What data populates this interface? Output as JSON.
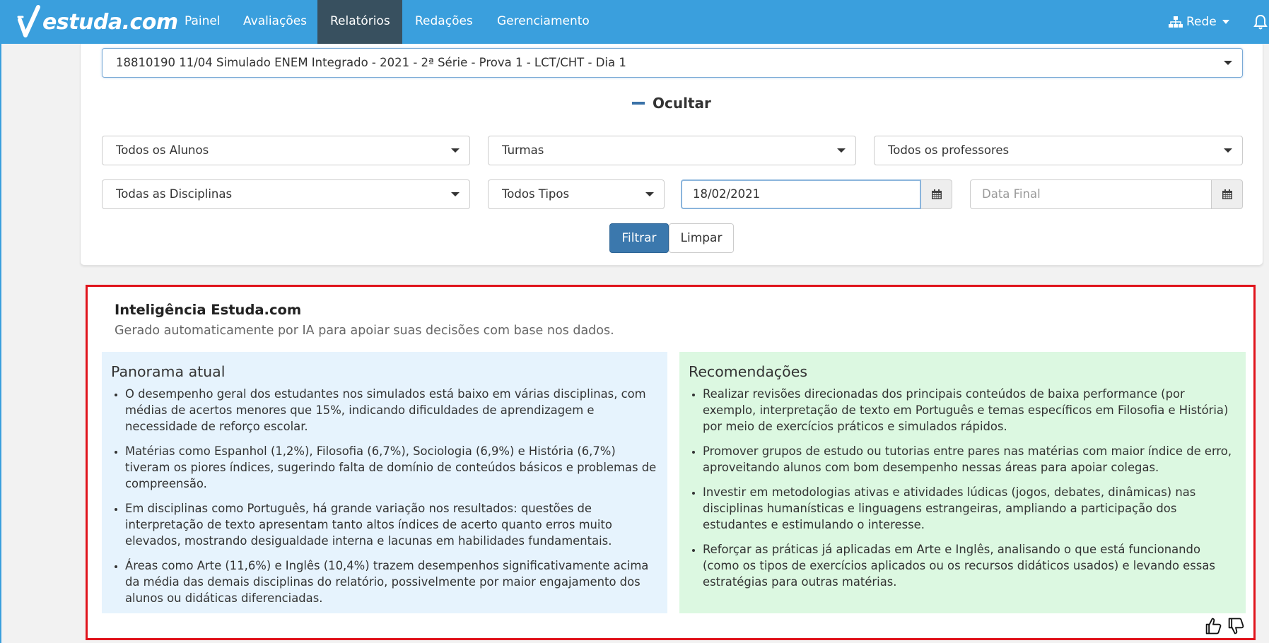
{
  "app": {
    "logo_text": "estuda.com"
  },
  "nav": {
    "items": [
      {
        "label": "Painel"
      },
      {
        "label": "Avaliações"
      },
      {
        "label": "Relatórios"
      },
      {
        "label": "Redações"
      },
      {
        "label": "Gerenciamento"
      }
    ],
    "active": "Relatórios",
    "right_menu": "Rede"
  },
  "filters": {
    "exam_select": "18810190 11/04 Simulado ENEM Integrado - 2021 - 2ª Série - Prova 1 - LCT/CHT - Dia 1",
    "toggle_label": "Ocultar",
    "students": "Todos os Alunos",
    "classes": "Turmas",
    "teachers": "Todos os professores",
    "subjects": "Todas as Disciplinas",
    "types": "Todos Tipos",
    "start_date": "18/02/2021",
    "end_date_placeholder": "Data Final",
    "filter_button": "Filtrar",
    "clear_button": "Limpar"
  },
  "ai": {
    "title": "Inteligência Estuda.com",
    "subtitle": "Gerado automaticamente por IA para apoiar suas decisões com base nos dados.",
    "panorama": {
      "heading": "Panorama atual",
      "items": [
        "O desempenho geral dos estudantes nos simulados está baixo em várias disciplinas, com médias de acertos menores que 15%, indicando dificuldades de aprendizagem e necessidade de reforço escolar.",
        "Matérias como Espanhol (1,2%), Filosofia (6,7%), Sociologia (6,9%) e História (6,7%) tiveram os piores índices, sugerindo falta de domínio de conteúdos básicos e problemas de compreensão.",
        "Em disciplinas como Português, há grande variação nos resultados: questões de interpretação de texto apresentam tanto altos índices de acerto quanto erros muito elevados, mostrando desigualdade interna e lacunas em habilidades fundamentais.",
        "Áreas como Arte (11,6%) e Inglês (10,4%) trazem desempenhos significativamente acima da média das demais disciplinas do relatório, possivelmente por maior engajamento dos alunos ou didáticas diferenciadas."
      ]
    },
    "recommendations": {
      "heading": "Recomendações",
      "items": [
        "Realizar revisões direcionadas dos principais conteúdos de baixa performance (por exemplo, interpretação de texto em Português e temas específicos em Filosofia e História) por meio de exercícios práticos e simulados rápidos.",
        "Promover grupos de estudo ou tutorias entre pares nas matérias com maior índice de erro, aproveitando alunos com bom desempenho nessas áreas para apoiar colegas.",
        "Investir em metodologias ativas e atividades lúdicas (jogos, debates, dinâmicas) nas disciplinas humanísticas e linguagens estrangeiras, ampliando a participação dos estudantes e estimulando o interesse.",
        "Reforçar as práticas já aplicadas em Arte e Inglês, analisando o que está funcionando (como os tipos de exercícios aplicados ou os recursos didáticos usados) e levando essas estratégias para outras matérias."
      ]
    }
  },
  "icons": {
    "bell": "bell-icon",
    "network": "sitemap-icon",
    "calendar": "calendar-icon",
    "thumbs_up": "thumbs-up-icon",
    "thumbs_down": "thumbs-down-icon"
  },
  "colors": {
    "navbar": "#3a9fdd",
    "nav_active": "#38505f",
    "primary_button": "#3b78ad",
    "highlight_border": "#e0141c",
    "panorama_bg": "#e6f3fd",
    "recommendations_bg": "#dcf8e1"
  }
}
